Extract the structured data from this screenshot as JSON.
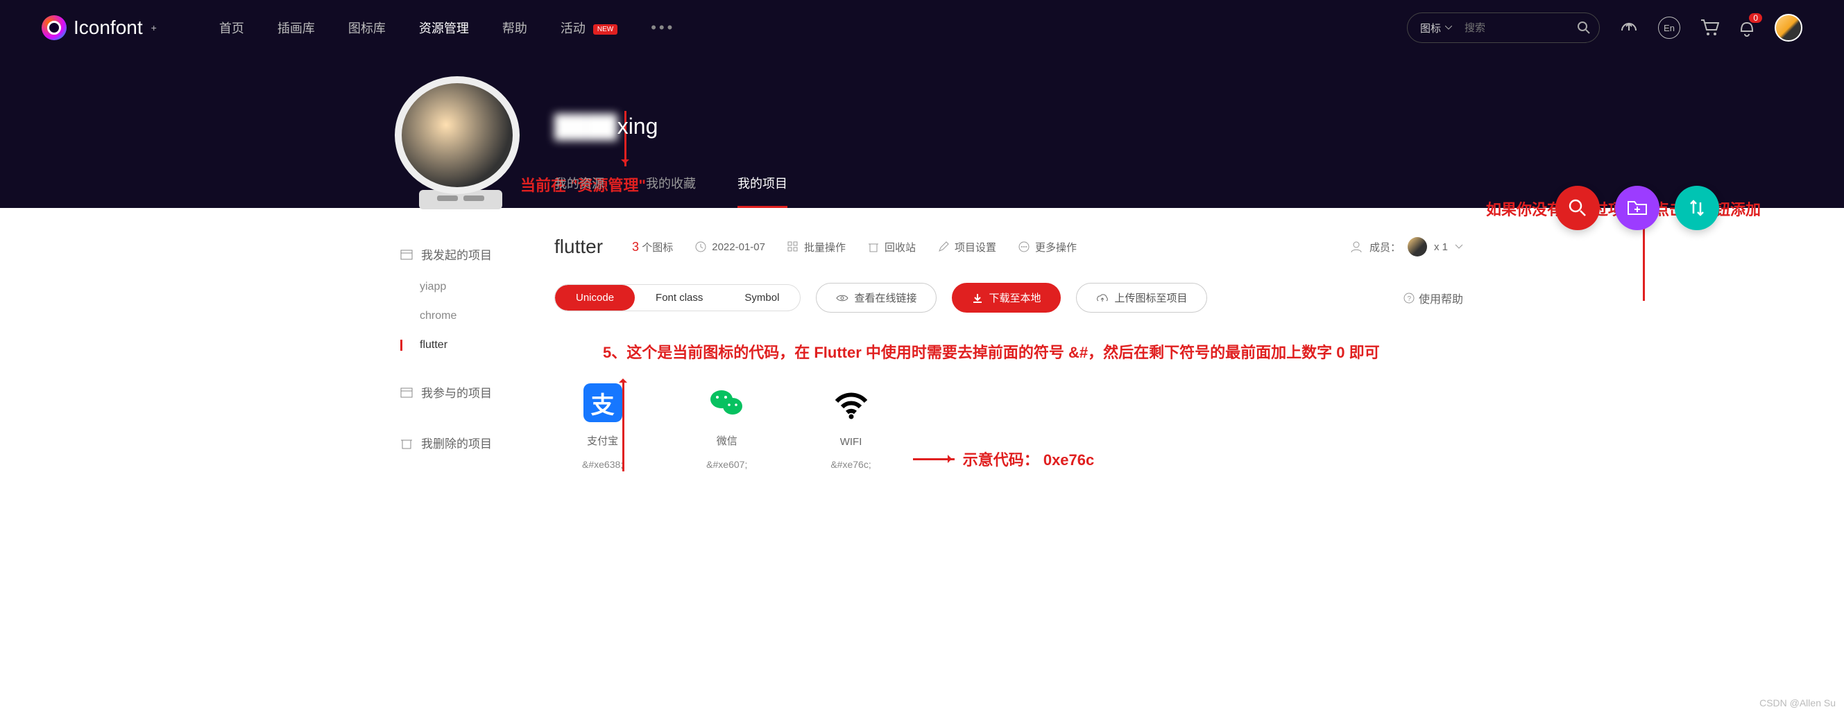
{
  "header": {
    "logo": "Iconfont",
    "nav": [
      "首页",
      "插画库",
      "图标库",
      "资源管理",
      "帮助",
      "活动"
    ],
    "new_badge": "NEW",
    "search_type": "图标",
    "search_placeholder": "搜索",
    "lang": "En",
    "notif_count": "0"
  },
  "profile": {
    "username_suffix": "xing",
    "tabs": [
      "我的资源",
      "我的收藏",
      "我的项目"
    ],
    "active_tab": 2
  },
  "annotations": {
    "a1": "当前在 \"资源管理\"",
    "a2": "如果你没有添加过项目，点击该按钮添加",
    "a3": "5、这个是当前图标的代码，在 Flutter 中使用时需要去掉前面的符号 &#，然后在剩下符号的最前面加上数字 0 即可",
    "a4": "示意代码： 0xe76c"
  },
  "sidebar": {
    "groups": [
      {
        "label": "我发起的项目",
        "items": [
          "yiapp",
          "chrome",
          "flutter"
        ],
        "active": 2
      },
      {
        "label": "我参与的项目"
      },
      {
        "label": "我删除的项目"
      }
    ]
  },
  "project": {
    "name": "flutter",
    "count": "3",
    "count_unit": "个图标",
    "date": "2022-01-07",
    "batch": "批量操作",
    "trash": "回收站",
    "settings": "项目设置",
    "more": "更多操作",
    "members_label": "成员：",
    "members_count": "x 1"
  },
  "actions": {
    "tabs": [
      "Unicode",
      "Font class",
      "Symbol"
    ],
    "view_online": "查看在线链接",
    "download": "下载至本地",
    "upload": "上传图标至项目",
    "help": "使用帮助"
  },
  "icons": [
    {
      "label": "支付宝",
      "code": "&#xe638;"
    },
    {
      "label": "微信",
      "code": "&#xe607;"
    },
    {
      "label": "WIFI",
      "code": "&#xe76c;"
    }
  ],
  "watermark": "CSDN @Allen Su"
}
